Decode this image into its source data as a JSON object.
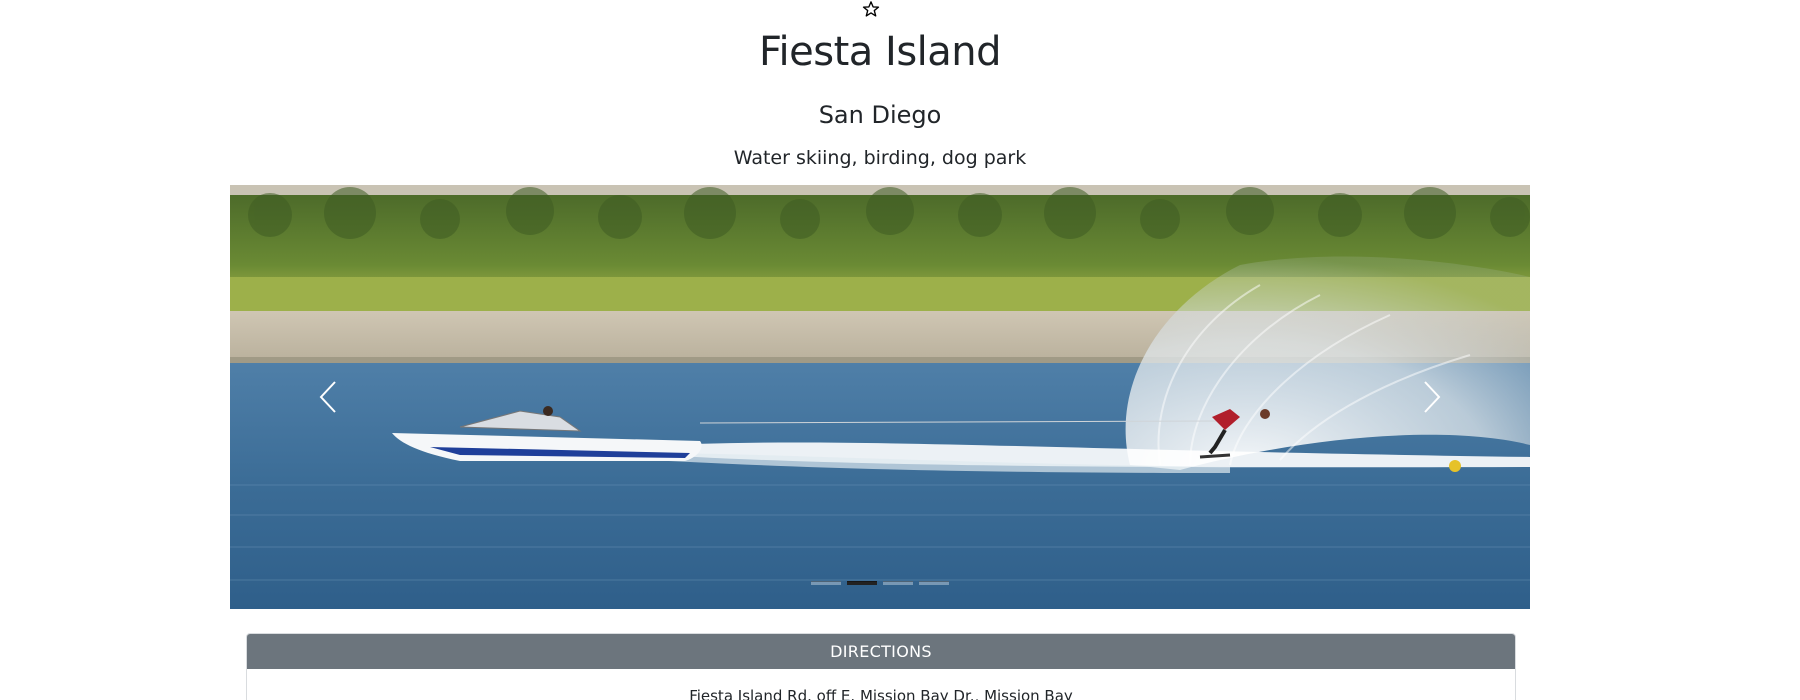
{
  "place": {
    "name": "Fiesta Island",
    "city": "San Diego",
    "activities": "Water skiing, birding, dog park"
  },
  "favorite": {
    "icon": "star-outline-icon"
  },
  "carousel": {
    "prev_icon": "chevron-left-icon",
    "next_icon": "chevron-right-icon",
    "slide_count": 4,
    "active_index": 1,
    "image_description": "photo-water-skier-and-boat"
  },
  "directions": {
    "header": "DIRECTIONS",
    "text": "Fiesta Island Rd. off E. Mission Bay Dr., Mission Bay"
  }
}
